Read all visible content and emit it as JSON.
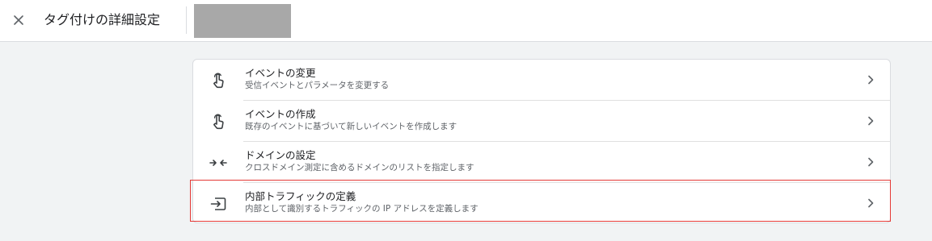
{
  "header": {
    "close_icon": "close-icon",
    "title": "タグ付けの詳細設定"
  },
  "colors": {
    "background": "#f1f3f4",
    "card": "#ffffff",
    "divider": "#dadce0",
    "highlight": "#e53935",
    "redacted": "#a8a8a8"
  },
  "settings": [
    {
      "icon": "touch-icon",
      "title": "イベントの変更",
      "subtitle": "受信イベントとパラメータを変更する"
    },
    {
      "icon": "touch-icon",
      "title": "イベントの作成",
      "subtitle": "既存のイベントに基づいて新しいイベントを作成します"
    },
    {
      "icon": "merge-arrows-icon",
      "title": "ドメインの設定",
      "subtitle": "クロスドメイン測定に含めるドメインのリストを指定します"
    },
    {
      "icon": "login-arrow-icon",
      "title": "内部トラフィックの定義",
      "subtitle": "内部として識別するトラフィックの IP アドレスを定義します",
      "highlighted": true
    }
  ]
}
